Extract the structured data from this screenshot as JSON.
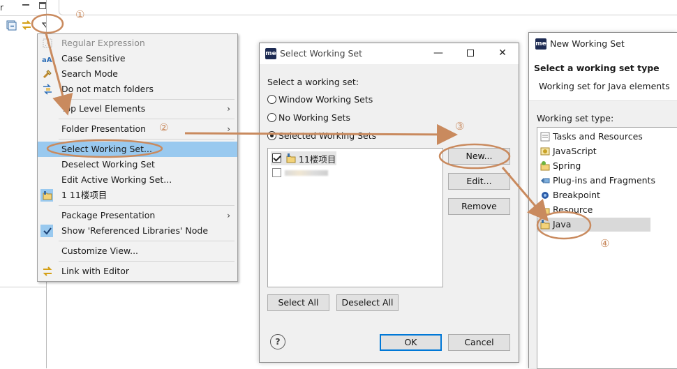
{
  "background": {
    "view_tab_fragment": "r"
  },
  "menu": {
    "items": [
      {
        "label": "Regular Expression",
        "disabled": true,
        "icon": "regex-icon"
      },
      {
        "label": "Case Sensitive",
        "icon": "case-sensitive-icon"
      },
      {
        "label": "Search Mode",
        "icon": "search-mode-icon"
      },
      {
        "label": "Do not match folders",
        "icon": "folder-filter-icon"
      },
      {
        "label": "Top Level Elements",
        "submenu": true
      },
      {
        "label": "Folder Presentation",
        "submenu": true
      },
      {
        "label": "Select Working Set...",
        "selected": true
      },
      {
        "label": "Deselect Working Set"
      },
      {
        "label": "Edit Active Working Set..."
      },
      {
        "label": "1 11楼项目",
        "icon": "working-set-icon"
      },
      {
        "label": "Package Presentation",
        "submenu": true
      },
      {
        "label": "Show 'Referenced Libraries' Node",
        "icon": "checkmark-icon"
      },
      {
        "label": "Customize View..."
      },
      {
        "label": "Link with Editor",
        "icon": "link-with-editor-icon"
      }
    ]
  },
  "dialog_select": {
    "logo": "me",
    "title": "Select Working Set",
    "prompt": "Select a working set:",
    "options": [
      {
        "label": "Window Working Sets",
        "checked": false
      },
      {
        "label": "No Working Sets",
        "checked": false
      },
      {
        "label": "Selected Working Sets",
        "checked": true
      }
    ],
    "working_sets": [
      {
        "label": "11楼项目",
        "checked": true
      }
    ],
    "buttons": {
      "new": "New...",
      "edit": "Edit...",
      "remove": "Remove",
      "select_all": "Select All",
      "deselect_all": "Deselect All",
      "ok": "OK",
      "cancel": "Cancel"
    },
    "help": "?"
  },
  "dialog_new": {
    "logo": "me",
    "title": "New Working Set",
    "heading": "Select a working set type",
    "description": "Working set for Java elements",
    "type_label": "Working set type:",
    "types": [
      {
        "label": "Tasks and Resources",
        "icon": "tasks-icon"
      },
      {
        "label": "JavaScript",
        "icon": "javascript-icon"
      },
      {
        "label": "Spring",
        "icon": "spring-icon"
      },
      {
        "label": "Plug-ins and Fragments",
        "icon": "plugin-icon"
      },
      {
        "label": "Breakpoint",
        "icon": "breakpoint-icon"
      },
      {
        "label": "Resource",
        "icon": "resource-folder-icon"
      },
      {
        "label": "Java",
        "icon": "java-working-set-icon",
        "selected": true
      }
    ]
  },
  "annotations": [
    "①",
    "②",
    "③",
    "④"
  ],
  "colors": {
    "annotation": "#c98a5e",
    "selection": "#99c9ef",
    "default_button": "#0078d7"
  }
}
